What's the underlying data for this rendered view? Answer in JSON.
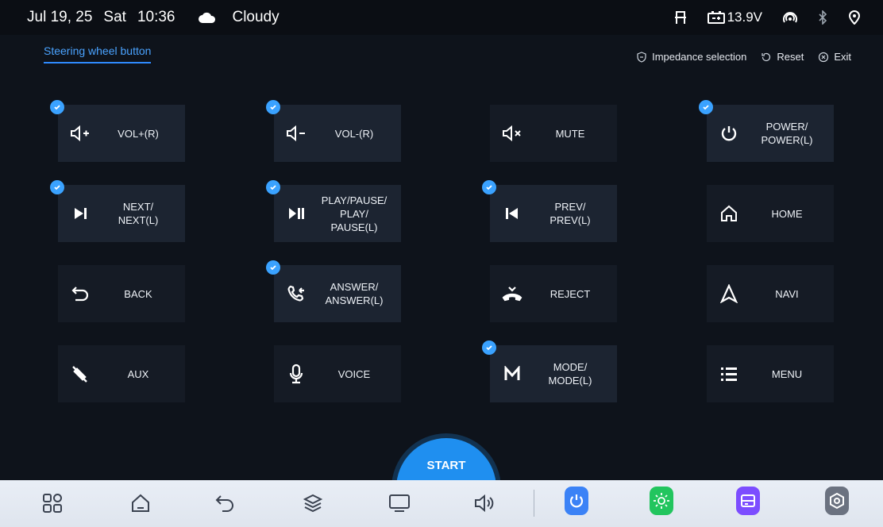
{
  "status": {
    "date": "Jul 19, 25",
    "day": "Sat",
    "time": "10:36",
    "weather": "Cloudy",
    "voltage": "13.9V"
  },
  "page": {
    "title": "Steering wheel button",
    "actions": {
      "impedance": "Impedance selection",
      "reset": "Reset",
      "exit": "Exit"
    }
  },
  "buttons": [
    {
      "label": "VOL+(R)",
      "icon": "volume-up-icon",
      "checked": true
    },
    {
      "label": "VOL-(R)",
      "icon": "volume-down-icon",
      "checked": true
    },
    {
      "label": "MUTE",
      "icon": "mute-icon",
      "checked": false
    },
    {
      "label": "POWER/\nPOWER(L)",
      "icon": "power-icon",
      "checked": true
    },
    {
      "label": "NEXT/\nNEXT(L)",
      "icon": "next-track-icon",
      "checked": true
    },
    {
      "label": "PLAY/PAUSE/\nPLAY/\nPAUSE(L)",
      "icon": "play-pause-icon",
      "checked": true
    },
    {
      "label": "PREV/\nPREV(L)",
      "icon": "prev-track-icon",
      "checked": true
    },
    {
      "label": "HOME",
      "icon": "home-icon",
      "checked": false
    },
    {
      "label": "BACK",
      "icon": "back-icon",
      "checked": false
    },
    {
      "label": "ANSWER/\nANSWER(L)",
      "icon": "answer-call-icon",
      "checked": true
    },
    {
      "label": "REJECT",
      "icon": "reject-call-icon",
      "checked": false
    },
    {
      "label": "NAVI",
      "icon": "navigation-icon",
      "checked": false
    },
    {
      "label": "AUX",
      "icon": "aux-cable-icon",
      "checked": false
    },
    {
      "label": "VOICE",
      "icon": "microphone-icon",
      "checked": false
    },
    {
      "label": "MODE/\nMODE(L)",
      "icon": "mode-icon",
      "checked": true
    },
    {
      "label": "MENU",
      "icon": "menu-icon",
      "checked": false
    }
  ],
  "start_label": "START",
  "dock": {
    "items": [
      "apps-icon",
      "home-icon",
      "back-icon",
      "layers-icon",
      "screen-icon",
      "volume-icon",
      "power-app-icon",
      "brightness-app-icon",
      "card-app-icon",
      "settings-app-icon"
    ]
  },
  "colors": {
    "accent": "#3aa2ff",
    "button_checked": "#1c2431",
    "button_unchecked": "#151b25",
    "start": "#1f8ff0",
    "power_app": "#3b82f6",
    "brightness_app": "#22c55e",
    "card_app": "#7c4dff",
    "settings_app": "#6b7280"
  }
}
